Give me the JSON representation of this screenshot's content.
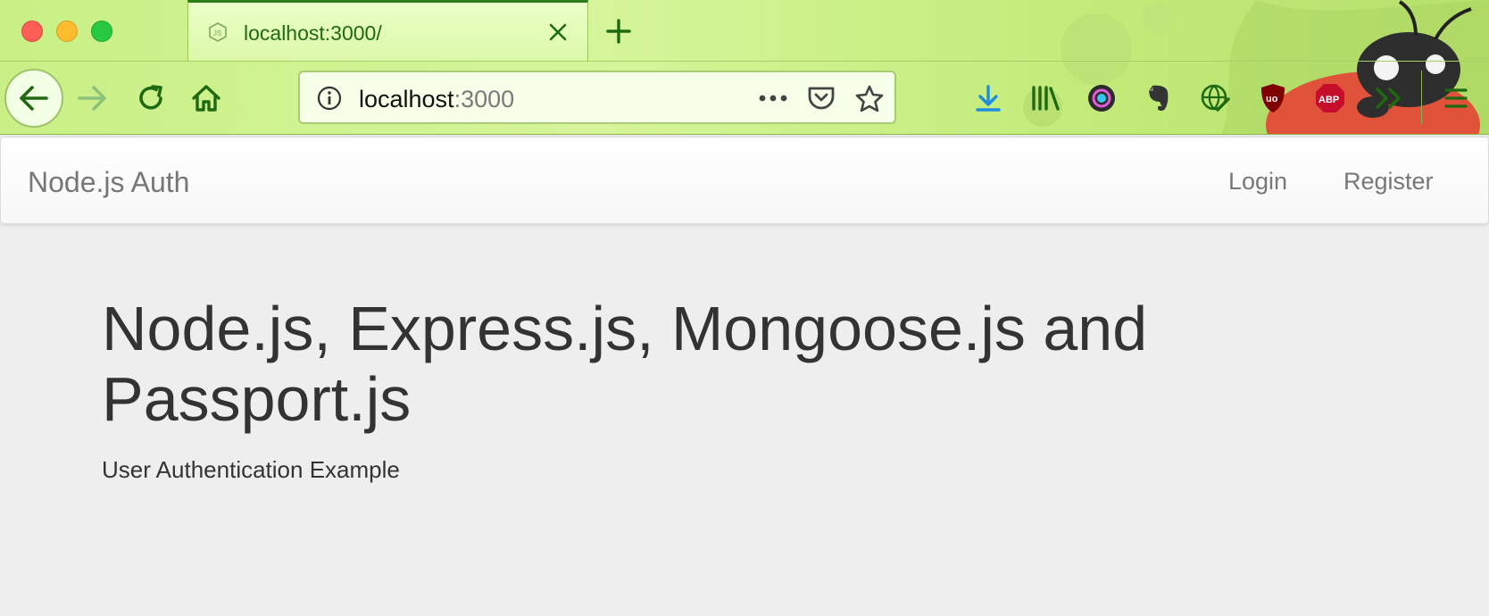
{
  "window": {
    "controls": [
      "close",
      "minimize",
      "zoom"
    ]
  },
  "tab": {
    "title": "localhost:3000/",
    "favicon": "nodejs-icon",
    "close_icon": "close-icon"
  },
  "toolbar": {
    "back_icon": "arrow-left-icon",
    "forward_icon": "arrow-right-icon",
    "reload_icon": "reload-icon",
    "home_icon": "home-icon",
    "new_tab_icon": "plus-icon",
    "url_host": "localhost",
    "url_port": ":3000",
    "info_icon": "info-icon",
    "page_actions_icon": "more-icon",
    "pocket_icon": "pocket-icon",
    "bookmark_icon": "star-icon",
    "extensions": [
      "download-icon",
      "library-icon",
      "camera-extension-icon",
      "evernote-icon",
      "globe-extension-icon",
      "ublock-icon",
      "adblock-plus-icon",
      "overflow-chevron-icon",
      "hamburger-menu-icon"
    ],
    "abp_label": "ABP",
    "ublock_label": "uo"
  },
  "site_nav": {
    "brand": "Node.js Auth",
    "login": "Login",
    "register": "Register"
  },
  "jumbotron": {
    "heading": "Node.js, Express.js, Mongoose.js and Passport.js",
    "subheading": "User Authentication Example"
  },
  "colors": {
    "chrome_green": "#c9ef86",
    "accent_green": "#1f6a10",
    "page_bg": "#eeeeee",
    "text_dark": "#333333",
    "nav_text": "#777777"
  }
}
